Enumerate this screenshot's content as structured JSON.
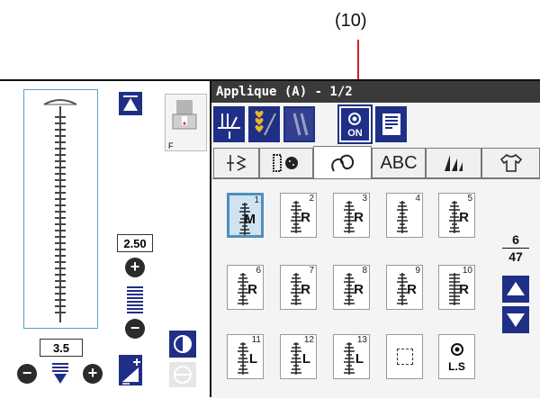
{
  "callout": {
    "label": "(10)"
  },
  "screen_title": "Applique (A) - 1/2",
  "toolbar": {
    "buttons": [
      {
        "icon": "needle-threader-icon"
      },
      {
        "icon": "favorite-hearts-icon"
      },
      {
        "icon": "twin-needle-icon"
      },
      {
        "icon": "lock-stitch-on-icon",
        "label": "ON"
      },
      {
        "icon": "pattern-info-icon"
      }
    ]
  },
  "tabs": [
    {
      "icon": "utility-stitch-icon"
    },
    {
      "icon": "buttonhole-icon"
    },
    {
      "icon": "decorative-stitch-icon"
    },
    {
      "label": "ABC"
    },
    {
      "icon": "quilt-icon"
    },
    {
      "icon": "garment-icon"
    }
  ],
  "stitches": [
    {
      "num": "1",
      "letter": "M",
      "selected": true
    },
    {
      "num": "2",
      "letter": "R"
    },
    {
      "num": "3",
      "letter": "R"
    },
    {
      "num": "4",
      "letter": ""
    },
    {
      "num": "5",
      "letter": "R"
    },
    {
      "num": "6",
      "letter": "R"
    },
    {
      "num": "7",
      "letter": "R"
    },
    {
      "num": "8",
      "letter": "R"
    },
    {
      "num": "9",
      "letter": "R"
    },
    {
      "num": "10",
      "letter": "R"
    },
    {
      "num": "11",
      "letter": "L"
    },
    {
      "num": "12",
      "letter": "L"
    },
    {
      "num": "13",
      "letter": "L"
    },
    {
      "num": "",
      "letter": ""
    },
    {
      "num": "",
      "letter": "L.S"
    }
  ],
  "pagination": {
    "current": "6",
    "total": "47"
  },
  "left_panel": {
    "presser_foot": "F",
    "stitch_width": "2.50",
    "stitch_length": "3.5"
  },
  "colors": {
    "accent_blue": "#1f2f86",
    "callout_red": "#d0202a",
    "title_bar": "#3a3a3a"
  }
}
